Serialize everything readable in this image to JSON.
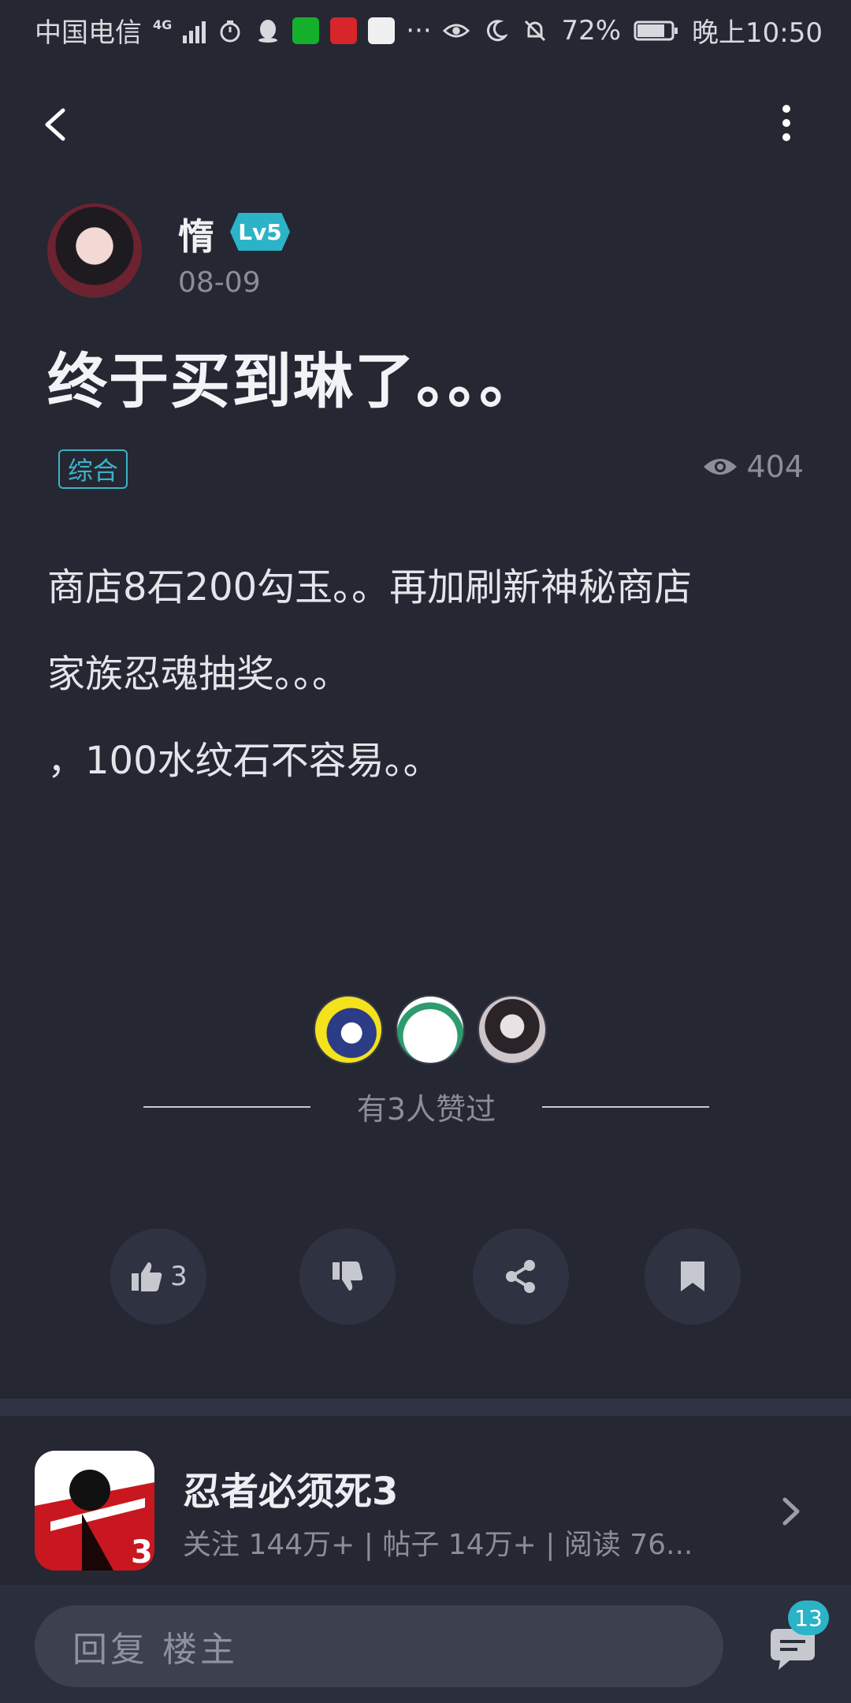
{
  "status_bar": {
    "carrier": "中国电信",
    "network": "4G",
    "battery_percent": "72%",
    "time": "晚上10:50",
    "overflow": "···"
  },
  "post": {
    "author": {
      "name": "惰",
      "level": "Lv5",
      "date": "08-09"
    },
    "title": "终于买到琳了。。。",
    "tag": "综合",
    "views": "404",
    "content": [
      "商店8石200勾玉。。再加刷新神秘商店",
      "家族忍魂抽奖。。。",
      "，100水纹石不容易。。"
    ],
    "likes_summary": "有3人赞过"
  },
  "actions": {
    "like_count": "3"
  },
  "game": {
    "name": "忍者必须死3",
    "stats": "关注 144万+  |  帖子 14万+  |  阅读 76...",
    "icon_badge": "3"
  },
  "reply": {
    "placeholder": "回复  楼主",
    "comment_count": "13"
  },
  "colors": {
    "background": "#252733",
    "accent": "#2bb3c8",
    "muted": "#8b8e99"
  }
}
